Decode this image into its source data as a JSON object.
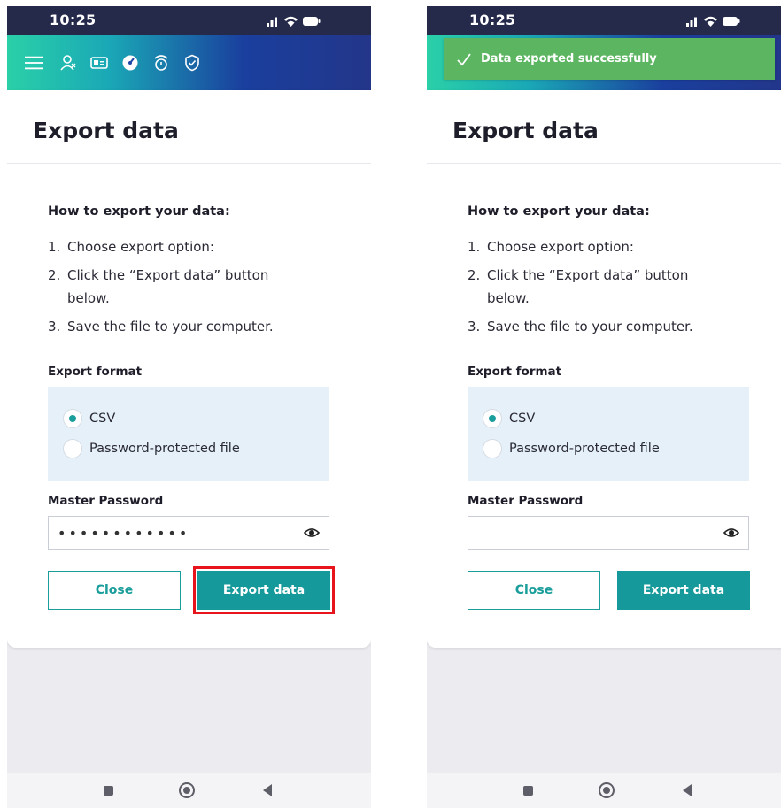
{
  "panels": [
    {
      "status_time": "10:25",
      "toast": null,
      "page_title": "Export data",
      "instructions_heading": "How to export your data:",
      "steps": [
        {
          "num": "1.",
          "text": "Choose export option:"
        },
        {
          "num": "2.",
          "text": "Click the “Export data” button below."
        },
        {
          "num": "3.",
          "text": "Save the file to your computer."
        }
      ],
      "export_format_label": "Export format",
      "format_options": [
        {
          "label": "CSV",
          "selected": true
        },
        {
          "label": "Password-protected file",
          "selected": false
        }
      ],
      "master_password_label": "Master Password",
      "master_password_value": "••••••••••••",
      "close_label": "Close",
      "export_label": "Export data",
      "export_highlighted": true
    },
    {
      "status_time": "10:25",
      "toast": "Data exported successfully",
      "page_title": "Export data",
      "instructions_heading": "How to export your data:",
      "steps": [
        {
          "num": "1.",
          "text": "Choose export option:"
        },
        {
          "num": "2.",
          "text": "Click the “Export data” button below."
        },
        {
          "num": "3.",
          "text": "Save the file to your computer."
        }
      ],
      "export_format_label": "Export format",
      "format_options": [
        {
          "label": "CSV",
          "selected": true
        },
        {
          "label": "Password-protected file",
          "selected": false
        }
      ],
      "master_password_label": "Master Password",
      "master_password_value": "",
      "close_label": "Close",
      "export_label": "Export data",
      "export_highlighted": false
    }
  ],
  "nav_icons": [
    "menu-icon",
    "user-icon",
    "id-card-icon",
    "dashboard-icon",
    "security-timer-icon",
    "shield-check-icon"
  ],
  "colors": {
    "accent": "#16999a",
    "toast": "#5cb561",
    "highlight": "#e8141b",
    "status_bar": "#25294a"
  }
}
